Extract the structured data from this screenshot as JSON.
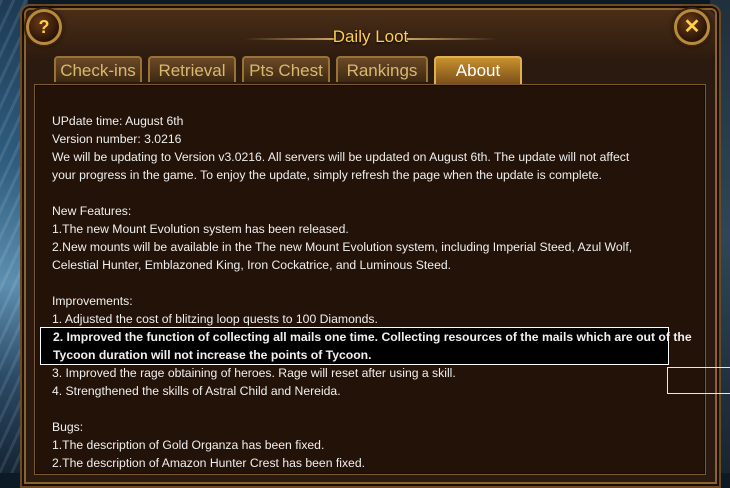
{
  "window": {
    "title": "Daily Loot",
    "help_label": "?",
    "close_label": "✕"
  },
  "tabs": [
    {
      "label": "Check-ins",
      "active": false
    },
    {
      "label": "Retrieval",
      "active": false
    },
    {
      "label": "Pts Chest",
      "active": false
    },
    {
      "label": "Rankings",
      "active": false
    },
    {
      "label": "About",
      "active": true
    }
  ],
  "about": {
    "update_time": "UPdate time: August 6th",
    "version": "Version number: 3.0216",
    "intro_1": "We will be updating to Version v3.0216. All servers will be updated on August 6th. The update will not affect",
    "intro_2": "your progress in the game. To enjoy the update, simply refresh the page when the update is complete.",
    "features_heading": "New Features:",
    "feature_1": "1.The new Mount Evolution system has been released.",
    "feature_2a": "2.New mounts will be available in the The new Mount Evolution system, including Imperial Steed, Azul Wolf,",
    "feature_2b": "Celestial Hunter, Emblazoned King, Iron Cockatrice, and Luminous Steed.",
    "improvements_heading": "Improvements:",
    "improvement_1": "1. Adjusted the cost of blitzing loop quests to 100 Diamonds.",
    "improvement_2a": "2. Improved the function of collecting all mails one time. Collecting resources of the mails which are out of the",
    "improvement_2b": "Tycoon duration will not increase the points of Tycoon.",
    "improvement_3": "3. Improved the rage obtaining of heroes. Rage will reset after using a skill.",
    "improvement_4": "4. Strengthened the skills of Astral Child and Nereida.",
    "bugs_heading": "Bugs:",
    "bug_1": "1.The description of Gold Organza has been fixed.",
    "bug_2": "2.The description of Amazon Hunter Crest has been fixed."
  }
}
